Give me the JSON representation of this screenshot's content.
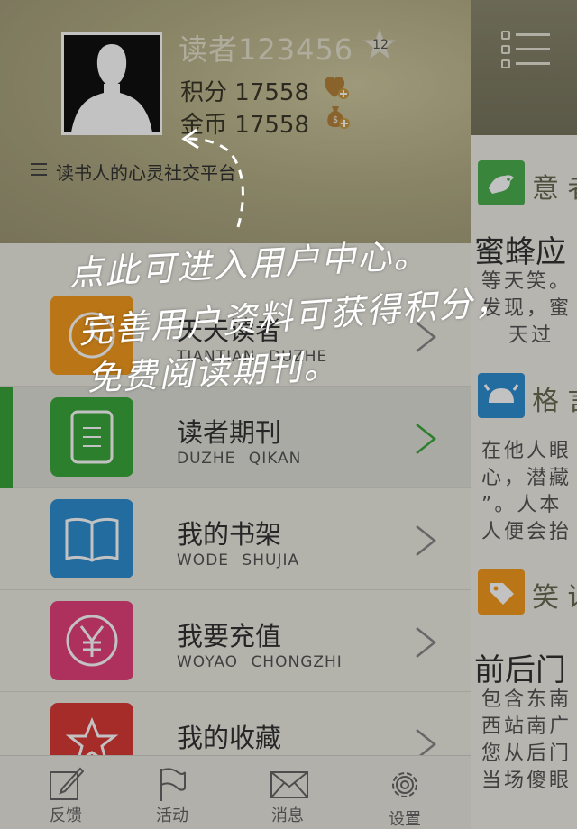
{
  "profile": {
    "username": "读者123456",
    "level": "12",
    "points_label": "积分",
    "points_value": "17558",
    "coins_label": "金币",
    "coins_value": "17558",
    "slogan": "读书人的心灵社交平台"
  },
  "menu": [
    {
      "title": "天天读者",
      "subtitle": "TIANTIAN DUZHE",
      "color": "#f39a1d",
      "icon": "clock-icon"
    },
    {
      "title": "读者期刊",
      "subtitle": "DUZHE QIKAN",
      "color": "#3aa83a",
      "icon": "magazine-icon",
      "active": true
    },
    {
      "title": "我的书架",
      "subtitle": "WODE SHUJIA",
      "color": "#2f8fd3",
      "icon": "book-icon"
    },
    {
      "title": "我要充值",
      "subtitle": "WOYAO CHONGZHI",
      "color": "#e4417a",
      "icon": "yen-icon"
    },
    {
      "title": "我的收藏",
      "subtitle": "",
      "color": "#d93a36",
      "icon": "star-icon"
    }
  ],
  "tabs": [
    {
      "label": "反馈",
      "icon": "feedback-icon"
    },
    {
      "label": "活动",
      "icon": "flag-icon"
    },
    {
      "label": "消息",
      "icon": "mail-icon"
    },
    {
      "label": "设置",
      "icon": "gear-icon"
    }
  ],
  "right": {
    "sections": [
      {
        "label": "意 者",
        "color": "#4caf50"
      },
      {
        "label": "格 言",
        "color": "#2f8fd3"
      },
      {
        "label": "笑 话",
        "color": "#f39a1d"
      }
    ],
    "article1_title": "蜜蜂应",
    "article1_body": "等天笑。\n发现，蜜\n   天过",
    "article2_body": "在他人眼\n心，潜藏\n”。人本\n人便会抬",
    "article3_title": "前后门",
    "article3_body": "包含东南\n西站南广\n您从后门\n当场傻眼"
  },
  "hint": {
    "line1": "点此可进入用户中心。",
    "line2": "完善用户资料可获得积分，",
    "line3": "免费阅读期刊。"
  }
}
